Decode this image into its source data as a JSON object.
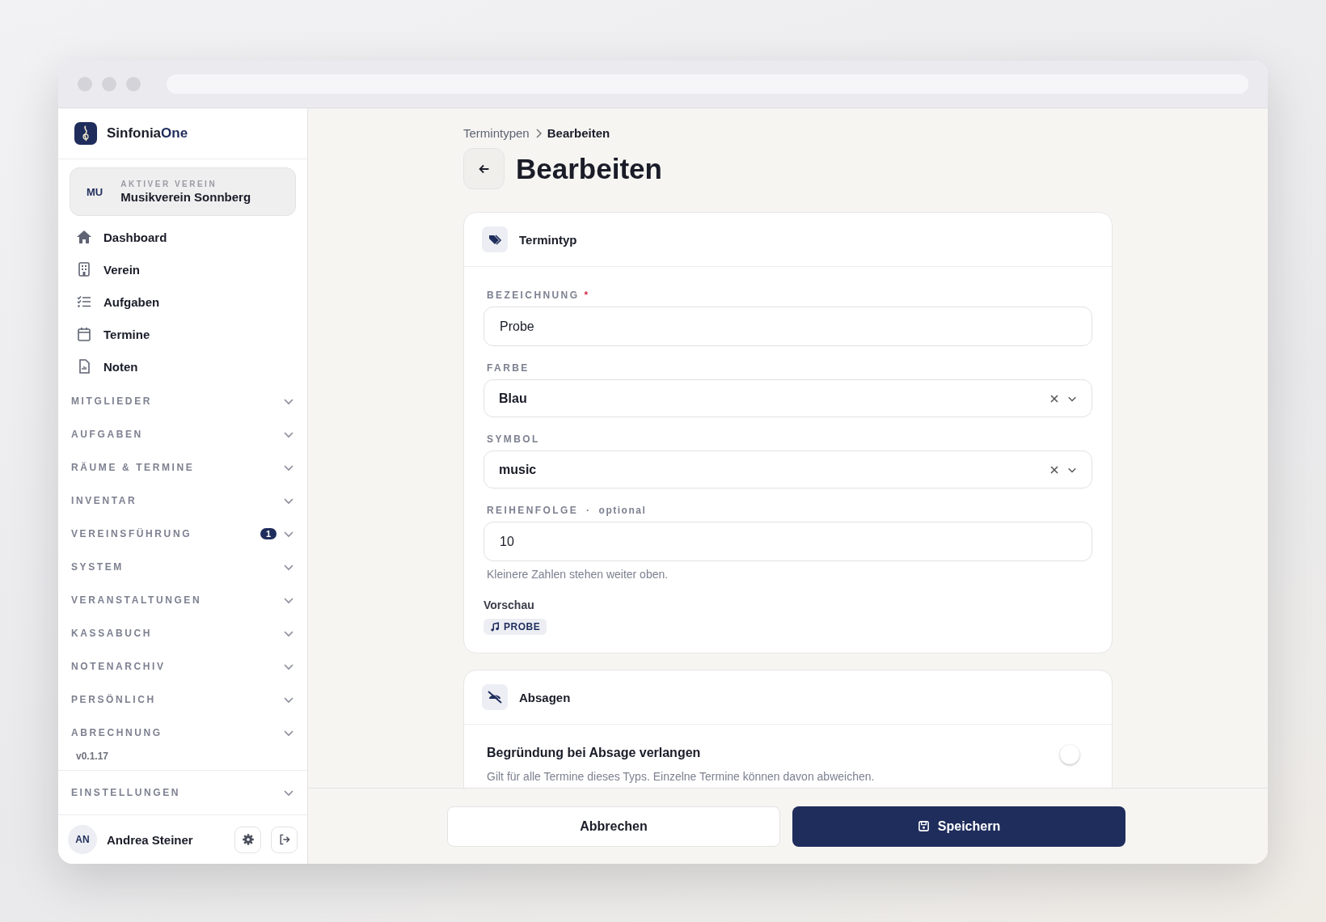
{
  "app": {
    "name_part1": "Sinfonia",
    "name_part2": "One"
  },
  "club": {
    "initials": "MU",
    "caption": "AKTIVER VEREIN",
    "name": "Musikverein Sonnberg"
  },
  "nav": [
    {
      "label": "Dashboard"
    },
    {
      "label": "Verein"
    },
    {
      "label": "Aufgaben"
    },
    {
      "label": "Termine"
    },
    {
      "label": "Noten"
    }
  ],
  "sections": [
    {
      "label": "MITGLIEDER",
      "expanded": false
    },
    {
      "label": "AUFGABEN",
      "expanded": false
    },
    {
      "label": "RÄUME & TERMINE",
      "expanded": false
    },
    {
      "label": "INVENTAR",
      "expanded": false
    },
    {
      "label": "VEREINSFÜHRUNG",
      "expanded": false,
      "badge": "1"
    },
    {
      "label": "SYSTEM",
      "expanded": false
    },
    {
      "label": "VERANSTALTUNGEN",
      "expanded": false
    },
    {
      "label": "KASSABUCH",
      "expanded": false
    },
    {
      "label": "NOTENARCHIV",
      "expanded": false
    },
    {
      "label": "PERSÖNLICH",
      "expanded": false
    },
    {
      "label": "ABRECHNUNG",
      "expanded": false
    }
  ],
  "version": "v0.1.17",
  "settings_section": {
    "label": "EINSTELLUNGEN",
    "expanded": false
  },
  "user": {
    "initials": "AN",
    "name": "Andrea Steiner"
  },
  "breadcrumb": [
    {
      "label": "Termintypen"
    },
    {
      "label": "Bearbeiten"
    }
  ],
  "page_title": "Bearbeiten",
  "card_type": {
    "title": "Termintyp",
    "fields": [
      {
        "kind": "text",
        "label": "BEZEICHNUNG",
        "required_mark": "*",
        "value": "Probe"
      },
      {
        "kind": "select",
        "label": "FARBE",
        "value": "Blau"
      },
      {
        "kind": "select",
        "label": "SYMBOL",
        "value": "music"
      },
      {
        "kind": "text",
        "label": "REIHENFOLGE",
        "separator": "·",
        "optional_note": "optional",
        "value": "10",
        "hint": "Kleinere Zahlen stehen weiter oben."
      }
    ],
    "preview_label": "Vorschau",
    "preview_chip": "PROBE"
  },
  "card_cancel": {
    "title": "Absagen",
    "toggle": {
      "label": "Begründung bei Absage verlangen",
      "on": false,
      "description": "Gilt für alle Termine dieses Typs. Einzelne Termine können davon abweichen."
    }
  },
  "buttons": [
    {
      "kind": "secondary",
      "label": "Abbrechen"
    },
    {
      "kind": "primary",
      "label": "Speichern"
    }
  ]
}
